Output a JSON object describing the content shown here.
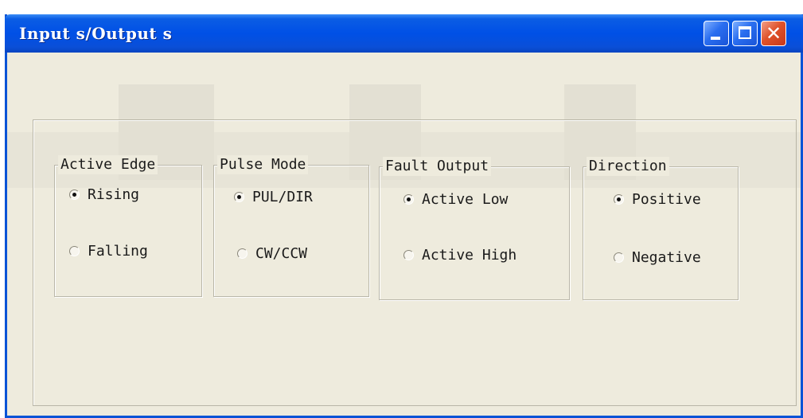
{
  "window": {
    "title": "Input s/Output s",
    "controls": {
      "minimize_icon": "minimize-icon",
      "maximize_icon": "maximize-icon",
      "close_icon": "close-icon",
      "close_glyph": "✕"
    },
    "colors": {
      "titlebar": "#0050e6",
      "face": "#ece9d8",
      "close_button": "#e0532b"
    }
  },
  "groups": [
    {
      "legend": "Active Edge",
      "options": [
        {
          "label": "Rising",
          "checked": true
        },
        {
          "label": "Falling",
          "checked": false
        }
      ]
    },
    {
      "legend": "Pulse Mode",
      "options": [
        {
          "label": "PUL/DIR",
          "checked": true
        },
        {
          "label": "CW/CCW",
          "checked": false
        }
      ]
    },
    {
      "legend": "Fault Output",
      "options": [
        {
          "label": "Active Low",
          "checked": true
        },
        {
          "label": "Active High",
          "checked": false
        }
      ]
    },
    {
      "legend": "Direction",
      "options": [
        {
          "label": "Positive",
          "checked": true
        },
        {
          "label": "Negative",
          "checked": false
        }
      ]
    }
  ]
}
